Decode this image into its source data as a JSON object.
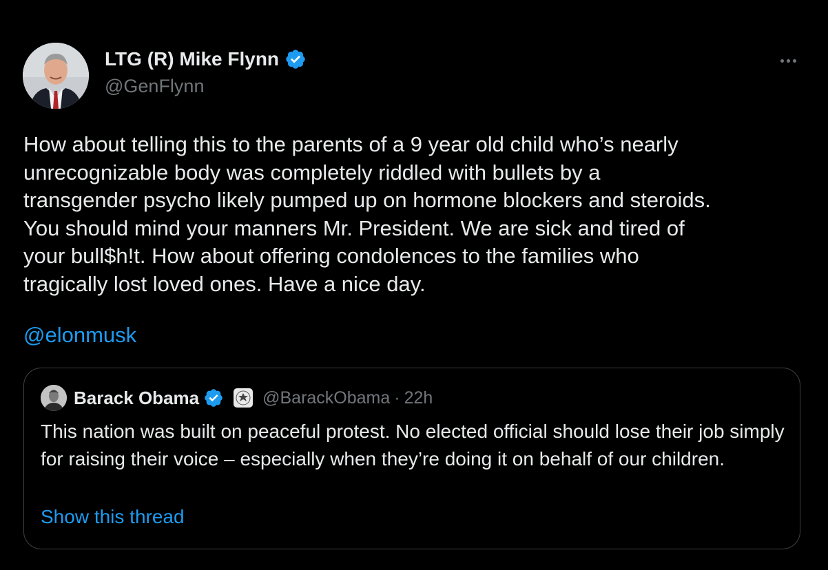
{
  "tweet": {
    "author": {
      "name": "LTG (R) Mike Flynn",
      "handle": "@GenFlynn",
      "verified_icon": "verified-badge-icon",
      "verified_color": "#1d9bf0"
    },
    "text": "How about telling this to the parents of a 9 year old child who’s nearly\nunrecognizable body was completely riddled with bullets by a\ntransgender psycho likely pumped up on hormone blockers and steroids.\nYou should mind your manners Mr. President. We are sick and tired of\nyour bull$h!t. How about offering condolences to the families who\ntragically lost loved ones. Have a nice day.",
    "mention": "@elonmusk",
    "more_icon": "more-horizontal-icon"
  },
  "quote": {
    "author": {
      "name": "Barack Obama",
      "handle": "@BarackObama",
      "separator": "·",
      "time": "22h",
      "verified_icon": "verified-badge-icon",
      "affiliate_icon": "government-seal-icon"
    },
    "text": "This nation was built on peaceful protest. No elected official should lose their job simply for raising their voice – especially when they’re doing it on behalf of our children.",
    "show_thread": "Show this thread"
  },
  "colors": {
    "background": "#000000",
    "text": "#e7e9ea",
    "muted": "#71767b",
    "link": "#1d9bf0",
    "border": "#3e4144"
  }
}
